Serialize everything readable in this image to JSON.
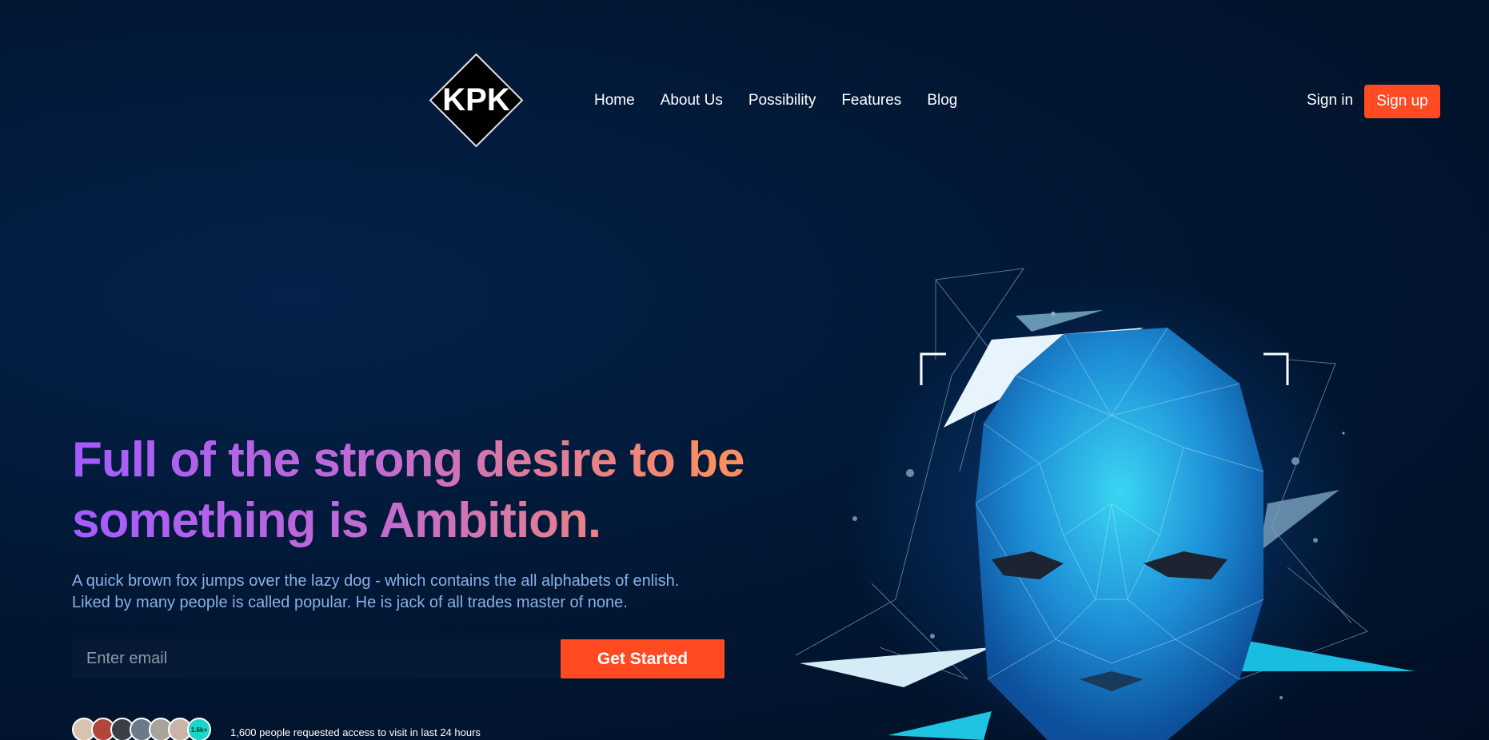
{
  "logo": {
    "text": "KPK"
  },
  "nav": {
    "items": [
      "Home",
      "About Us",
      "Possibility",
      "Features",
      "Blog"
    ]
  },
  "auth": {
    "signin_label": "Sign in",
    "signup_label": "Sign up"
  },
  "hero": {
    "headline_line1": "Full of the strong desire to be",
    "headline_line2": "something is Ambition.",
    "subtext_line1": "A quick brown fox jumps over the lazy dog - which contains the all alphabets of enlish.",
    "subtext_line2": "Liked by many people is called popular. He is jack of all trades master of none.",
    "email_placeholder": "Enter email",
    "cta_label": "Get Started",
    "avatar_count": "1.6k+",
    "requested_text": "1,600 people requested access to visit in last 24 hours"
  },
  "colors": {
    "accent": "#ff4a22",
    "gradient_start": "#a45bff",
    "gradient_end": "#ff8f5a",
    "background": "#021836"
  }
}
